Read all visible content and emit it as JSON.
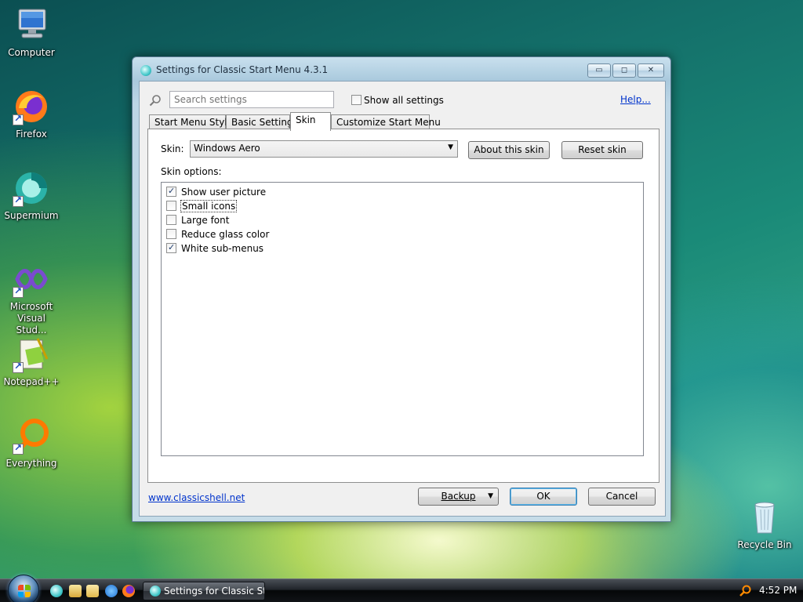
{
  "desktop": {
    "icons": [
      {
        "label": "Computer"
      },
      {
        "label": "Firefox"
      },
      {
        "label": "Supermium"
      },
      {
        "label": "Microsoft Visual Stud..."
      },
      {
        "label": "Notepad++"
      },
      {
        "label": "Everything"
      },
      {
        "label": "Recycle Bin"
      }
    ]
  },
  "window": {
    "title": "Settings for Classic Start Menu 4.3.1",
    "min_symbol": "▭",
    "max_symbol": "◻",
    "close_symbol": "✕"
  },
  "search": {
    "placeholder": "Search settings",
    "show_all_label": "Show all settings",
    "show_all_checked": false,
    "help_label": "Help..."
  },
  "tabs": [
    {
      "label": "Start Menu Style",
      "active": false
    },
    {
      "label": "Basic Settings",
      "active": false
    },
    {
      "label": "Skin",
      "active": true
    },
    {
      "label": "Customize Start Menu",
      "active": false
    }
  ],
  "skin": {
    "label": "Skin:",
    "selected": "Windows Aero",
    "about_button": "About this skin",
    "reset_button": "Reset skin",
    "options_label": "Skin options:",
    "options": [
      {
        "label": "Show user picture",
        "checked": true
      },
      {
        "label": "Small icons",
        "checked": false
      },
      {
        "label": "Large font",
        "checked": false
      },
      {
        "label": "Reduce glass color",
        "checked": false
      },
      {
        "label": "White sub-menus",
        "checked": true
      }
    ]
  },
  "footer": {
    "link": "www.classicshell.net",
    "backup": "Backup",
    "ok": "OK",
    "cancel": "Cancel"
  },
  "taskbar": {
    "task_label": "Settings for Classic St...",
    "clock": "4:52 PM"
  },
  "colors": {
    "link": "#0033cc",
    "ok_border": "#3c7fb1"
  }
}
